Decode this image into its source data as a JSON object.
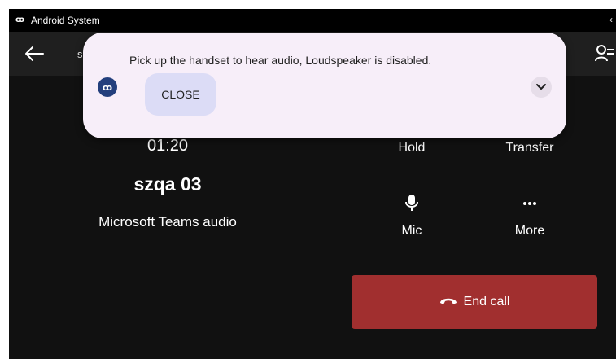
{
  "status_bar": {
    "app_name": "Android System",
    "logo_icon": "poly-logo-icon",
    "right_glyph": "‹"
  },
  "header": {
    "back_icon": "arrow-left-icon",
    "title": "s",
    "participants_icon": "participants-icon"
  },
  "call": {
    "timer": "01:20",
    "caller_name": "szqa 03",
    "call_type": "Microsoft Teams audio"
  },
  "actions": {
    "hold_label": "Hold",
    "transfer_label": "Transfer",
    "mic_label": "Mic",
    "more_label": "More",
    "mic_icon": "microphone-icon",
    "more_icon": "more-dots-icon"
  },
  "end_call": {
    "label": "End call",
    "icon": "phone-hangup-icon"
  },
  "notification": {
    "message": "Pick up the handset to hear audio, Loudspeaker is disabled.",
    "close_label": "CLOSE",
    "expand_icon": "chevron-down-icon"
  },
  "colors": {
    "background": "#111111",
    "top_bar": "#1f1f1f",
    "end_call": "#a12f2f",
    "notification_bg": "#f7eef9",
    "close_button": "#dcdcf6",
    "app_icon": "#233f7d"
  }
}
